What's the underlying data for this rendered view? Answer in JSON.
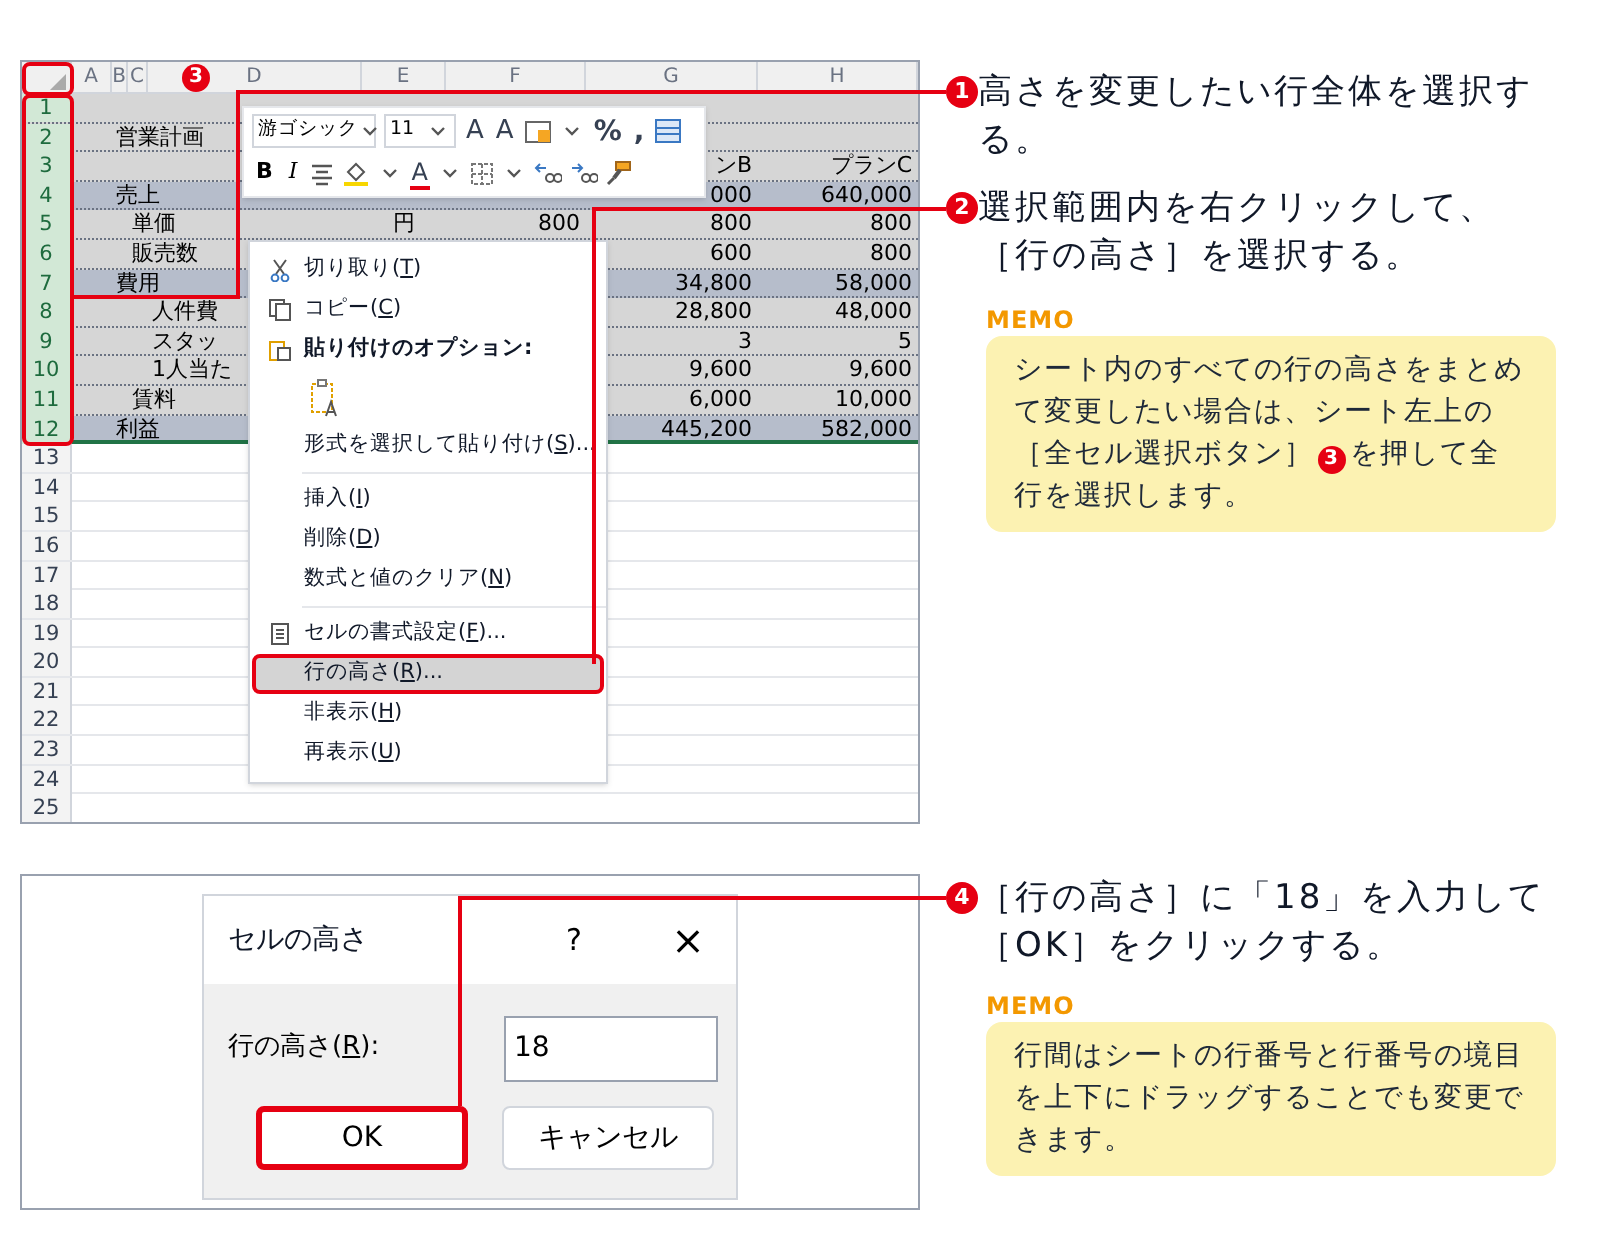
{
  "sheet": {
    "columns": [
      "A",
      "B",
      "C",
      "D",
      "E",
      "F",
      "G",
      "H"
    ],
    "rows": [
      {
        "number": "1",
        "selected": true,
        "kind": "plain"
      },
      {
        "number": "2",
        "selected": true,
        "kind": "plain",
        "cells": {
          "B": "営業計画"
        }
      },
      {
        "number": "3",
        "selected": true,
        "kind": "plain",
        "cells": {
          "G": "ンB",
          "H": "プランC"
        }
      },
      {
        "number": "4",
        "selected": true,
        "kind": "section",
        "cells": {
          "B": "売上",
          "G": "000",
          "H": "640,000"
        }
      },
      {
        "number": "5",
        "selected": true,
        "kind": "plain",
        "cells": {
          "C": "単価",
          "E": "円",
          "F": "800",
          "G": "800",
          "H": "800"
        }
      },
      {
        "number": "6",
        "selected": true,
        "kind": "plain",
        "cells": {
          "C": "販売数",
          "G": "600",
          "H": "800"
        }
      },
      {
        "number": "7",
        "selected": true,
        "kind": "section",
        "cells": {
          "B": "費用",
          "G": "34,800",
          "H": "58,000"
        }
      },
      {
        "number": "8",
        "selected": true,
        "kind": "plain",
        "cells": {
          "D": "人件費",
          "G": "28,800",
          "H": "48,000"
        }
      },
      {
        "number": "9",
        "selected": true,
        "kind": "plain",
        "cells": {
          "D": "スタッ",
          "G": "3",
          "H": "5"
        }
      },
      {
        "number": "10",
        "selected": true,
        "kind": "plain",
        "cells": {
          "D": "1人当た",
          "G": "9,600",
          "H": "9,600"
        }
      },
      {
        "number": "11",
        "selected": true,
        "kind": "plain",
        "cells": {
          "C": "賃料",
          "G": "6,000",
          "H": "10,000"
        }
      },
      {
        "number": "12",
        "selected": true,
        "kind": "section",
        "cells": {
          "B": "利益",
          "G": "445,200",
          "H": "582,000"
        }
      },
      {
        "number": "13",
        "selected": false
      },
      {
        "number": "14",
        "selected": false
      },
      {
        "number": "15",
        "selected": false
      },
      {
        "number": "16",
        "selected": false
      },
      {
        "number": "17",
        "selected": false
      },
      {
        "number": "18",
        "selected": false
      },
      {
        "number": "19",
        "selected": false
      },
      {
        "number": "20",
        "selected": false
      },
      {
        "number": "21",
        "selected": false
      },
      {
        "number": "22",
        "selected": false
      },
      {
        "number": "23",
        "selected": false
      },
      {
        "number": "24",
        "selected": false
      },
      {
        "number": "25",
        "selected": false
      }
    ],
    "badge": "3"
  },
  "mini_toolbar": {
    "font_controls": [
      {
        "kind": "dropdown",
        "text": "游ゴシック"
      },
      {
        "kind": "dropdown",
        "text": "11"
      },
      {
        "kind": "grow",
        "text": "A"
      },
      {
        "kind": "shrink",
        "text": "A"
      },
      {
        "kind": "style-menu"
      },
      {
        "kind": "glyph",
        "text": "%"
      },
      {
        "kind": "glyph",
        "text": ","
      },
      {
        "kind": "table-format"
      }
    ],
    "format_buttons": [
      {
        "kind": "bold",
        "text": "B"
      },
      {
        "kind": "italic",
        "text": "I"
      },
      {
        "kind": "align"
      },
      {
        "kind": "fill-color"
      },
      {
        "kind": "font-color",
        "text": "A"
      },
      {
        "kind": "borders"
      },
      {
        "kind": "decimal-more"
      },
      {
        "kind": "decimal-less"
      },
      {
        "kind": "painter"
      }
    ]
  },
  "context_menu": {
    "items": [
      {
        "kind": "cut",
        "before": "切り取り(",
        "accel": "T",
        "after": ")",
        "selected": false
      },
      {
        "kind": "copy",
        "before": "コピー(",
        "accel": "C",
        "after": ")",
        "selected": false
      },
      {
        "kind": "paste-header",
        "before": "貼り付けのオプション:",
        "selected": false
      },
      {
        "kind": "paste-option"
      },
      {
        "kind": "item",
        "before": "形式を選択して貼り付け(",
        "accel": "S",
        "after": ")...",
        "selected": false
      },
      {
        "kind": "separator"
      },
      {
        "kind": "item",
        "before": "挿入(",
        "accel": "I",
        "after": ")",
        "selected": false
      },
      {
        "kind": "item",
        "before": "削除(",
        "accel": "D",
        "after": ")",
        "selected": false
      },
      {
        "kind": "item",
        "before": "数式と値のクリア(",
        "accel": "N",
        "after": ")",
        "selected": false
      },
      {
        "kind": "separator"
      },
      {
        "kind": "format-cells",
        "before": "セルの書式設定(",
        "accel": "F",
        "after": ")...",
        "selected": false
      },
      {
        "kind": "item",
        "before": "行の高さ(",
        "accel": "R",
        "after": ")...",
        "selected": true
      },
      {
        "kind": "item",
        "before": "非表示(",
        "accel": "H",
        "after": ")",
        "selected": false
      },
      {
        "kind": "item",
        "before": "再表示(",
        "accel": "U",
        "after": ")",
        "selected": false
      }
    ]
  },
  "dialog": {
    "title": "セルの高さ",
    "help": "?",
    "close": "×",
    "field_label": {
      "before": "行の高さ(",
      "accel": "R",
      "after": "):"
    },
    "value": "18",
    "buttons": [
      {
        "label": "OK",
        "highlighted": true
      },
      {
        "label": "キャンセル",
        "highlighted": false
      }
    ]
  },
  "steps": [
    {
      "number": "1",
      "text": "高さを変更したい行全体を選択する。"
    },
    {
      "number": "2",
      "text": "選択範囲内を右クリックして、［行の高さ］を選択する。"
    },
    {
      "number": "4",
      "text": "［行の高さ］に「18」を入力して［OK］をクリックする。"
    }
  ],
  "memos": [
    {
      "label": "MEMO",
      "parts": [
        {
          "kind": "text",
          "text": "シート内のすべての行の高さをまとめて変更したい場合は、シート左上の［全セル選択ボタン］"
        },
        {
          "kind": "badge",
          "text": "3"
        },
        {
          "kind": "text",
          "text": "を押して全行を選択します。"
        }
      ]
    },
    {
      "label": "MEMO",
      "parts": [
        {
          "kind": "text",
          "text": "行間はシートの行番号と行番号の境目を上下にドラッグすることでも変更できます。"
        }
      ]
    }
  ]
}
